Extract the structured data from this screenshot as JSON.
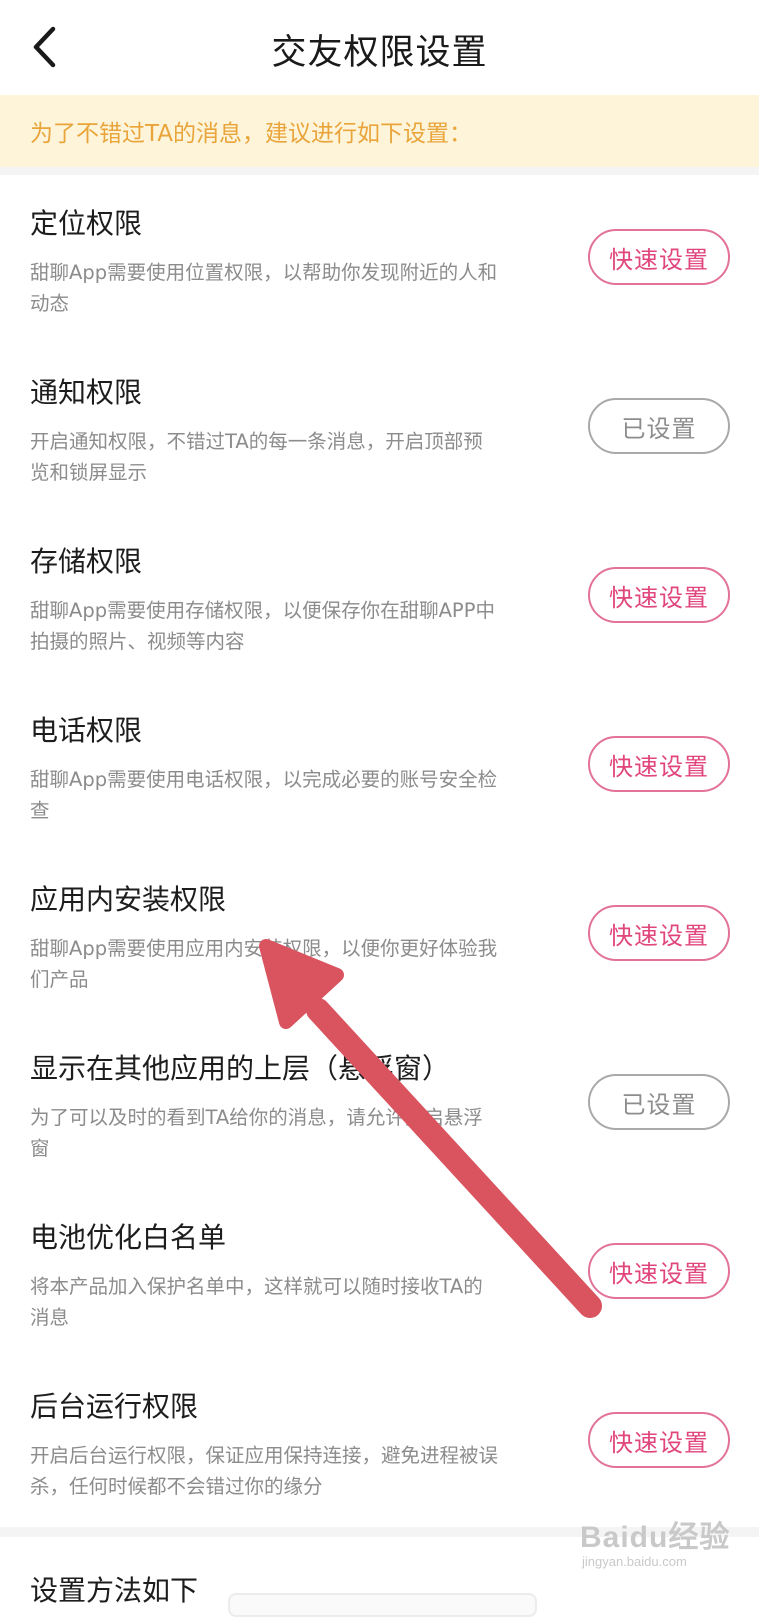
{
  "header": {
    "title": "交友权限设置",
    "back_icon": "chevron-left-icon"
  },
  "notice": {
    "text": "为了不错过TA的消息，建议进行如下设置："
  },
  "permissions": [
    {
      "title": "定位权限",
      "desc": "甜聊App需要使用位置权限，以帮助你发现附近的人和动态",
      "button": "快速设置",
      "status": "pending"
    },
    {
      "title": "通知权限",
      "desc": "开启通知权限，不错过TA的每一条消息，开启顶部预览和锁屏显示",
      "button": "已设置",
      "status": "done"
    },
    {
      "title": "存储权限",
      "desc": "甜聊App需要使用存储权限，以便保存你在甜聊APP中拍摄的照片、视频等内容",
      "button": "快速设置",
      "status": "pending"
    },
    {
      "title": "电话权限",
      "desc": "甜聊App需要使用电话权限，以完成必要的账号安全检查",
      "button": "快速设置",
      "status": "pending"
    },
    {
      "title": "应用内安装权限",
      "desc": "甜聊App需要使用应用内安装权限，以便你更好体验我们产品",
      "button": "快速设置",
      "status": "pending"
    },
    {
      "title": "显示在其他应用的上层（悬浮窗）",
      "desc": "为了可以及时的看到TA给你的消息，请允许开启悬浮窗",
      "button": "已设置",
      "status": "done"
    },
    {
      "title": "电池优化白名单",
      "desc": "将本产品加入保护名单中，这样就可以随时接收TA的消息",
      "button": "快速设置",
      "status": "pending"
    },
    {
      "title": "后台运行权限",
      "desc": "开启后台运行权限，保证应用保持连接，避免进程被误杀，任何时候都不会错过你的缘分",
      "button": "快速设置",
      "status": "pending"
    }
  ],
  "section": {
    "title": "设置方法如下"
  },
  "watermark": {
    "logo": "Baidu经验",
    "sub": "jingyan.baidu.com"
  },
  "colors": {
    "accent": "#e0457c",
    "accent_border": "#e2729a",
    "notice_bg": "#fdf4d9",
    "notice_text": "#e9a53b",
    "done_border": "#a9a9a9",
    "annotation_arrow": "#d9545f"
  }
}
